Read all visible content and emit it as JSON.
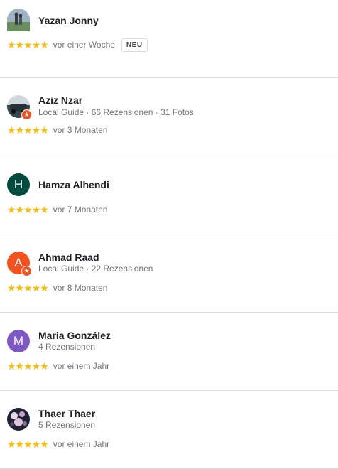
{
  "reviews": [
    {
      "name": "Yazan Jonny",
      "meta": "",
      "stars": "★★★★★",
      "date": "vor einer Woche",
      "badge": "NEU",
      "avatar_letter": "",
      "avatar_color": "#8fa3b5"
    },
    {
      "name": "Aziz Nzar",
      "meta": "Local Guide · 66 Rezensionen · 31 Fotos",
      "stars": "★★★★★",
      "date": "vor 3 Monaten",
      "badge": "",
      "avatar_letter": "",
      "avatar_color": "#4a5661"
    },
    {
      "name": "Hamza Alhendi",
      "meta": "",
      "stars": "★★★★★",
      "date": "vor 7 Monaten",
      "badge": "",
      "avatar_letter": "H",
      "avatar_color": "#004d40"
    },
    {
      "name": "Ahmad Raad",
      "meta": "Local Guide · 22 Rezensionen",
      "stars": "★★★★★",
      "date": "vor 8 Monaten",
      "badge": "",
      "avatar_letter": "A",
      "avatar_color": "#f4511e"
    },
    {
      "name": "Maria González",
      "meta": "4 Rezensionen",
      "stars": "★★★★★",
      "date": "vor einem Jahr",
      "badge": "",
      "avatar_letter": "M",
      "avatar_color": "#7e57c2"
    },
    {
      "name": "Thaer Thaer",
      "meta": "5 Rezensionen",
      "stars": "★★★★★",
      "date": "vor einem Jahr",
      "badge": "",
      "avatar_letter": "",
      "avatar_color": "#1f2235"
    }
  ],
  "colors": {
    "star": "#fbbc04",
    "divider": "#dadce0",
    "muted": "#70757a"
  },
  "rating": 5,
  "rating_max": 5
}
